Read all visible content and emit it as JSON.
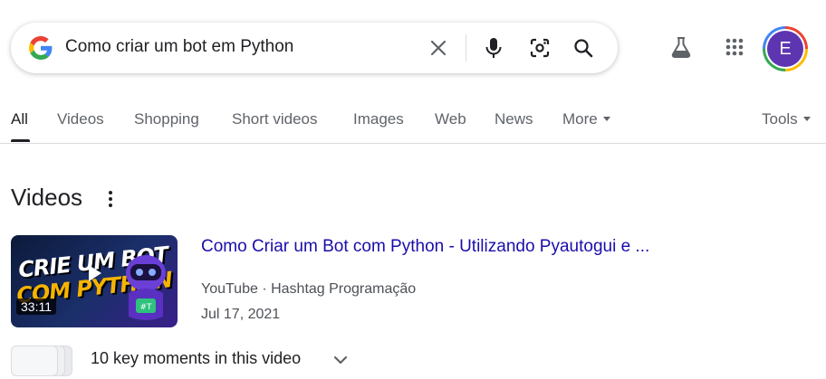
{
  "search": {
    "query": "Como criar um bot em Python",
    "icons": [
      "google-g-icon",
      "clear-icon",
      "microphone-icon",
      "lens-icon",
      "search-icon"
    ]
  },
  "header": {
    "icons": [
      "labs-flask-icon",
      "apps-grid-icon"
    ],
    "avatar_letter": "E",
    "avatar_color": "#5e35b1"
  },
  "tabs": {
    "all": "All",
    "videos": "Videos",
    "shopping": "Shopping",
    "short_videos": "Short videos",
    "images": "Images",
    "web": "Web",
    "news": "News",
    "more": "More",
    "tools": "Tools"
  },
  "section": {
    "title": "Videos"
  },
  "video": {
    "title": "Como Criar um Bot com Python - Utilizando Pyautogui e ...",
    "source": "YouTube · Hashtag Programação",
    "date": "Jul 17, 2021",
    "duration": "33:11",
    "thumb_line1": "CRIE UM BOT",
    "thumb_line2": "COM PYTHON",
    "key_moments": "10 key moments in this video"
  },
  "colors": {
    "link": "#1a0dab",
    "text": "#202124",
    "muted": "#5f6368"
  }
}
